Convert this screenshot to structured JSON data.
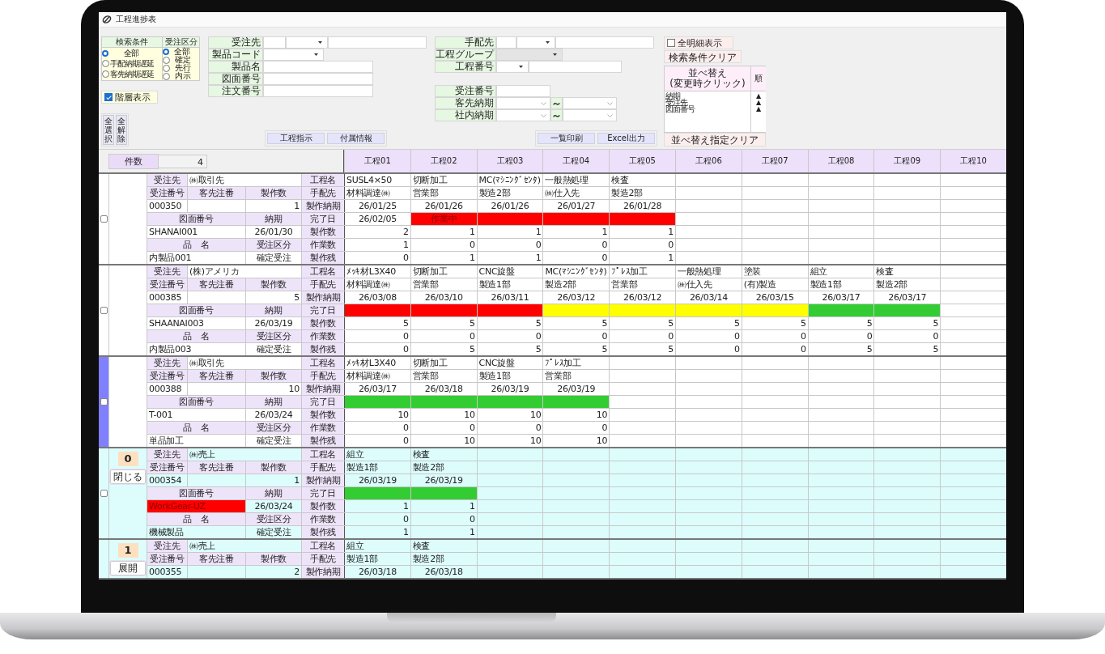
{
  "window": {
    "title": "工程進捗表"
  },
  "search": {
    "conditions": {
      "title": "検索条件",
      "options": [
        {
          "label": "全部",
          "selected": true
        },
        {
          "label": "手配納期遅延",
          "selected": false
        },
        {
          "label": "客先納期遅延",
          "selected": false
        }
      ]
    },
    "order_types": {
      "title": "受注区分",
      "options": [
        {
          "label": "全部",
          "selected": true
        },
        {
          "label": "確定",
          "selected": false
        },
        {
          "label": "先行",
          "selected": false
        },
        {
          "label": "内示",
          "selected": false
        }
      ]
    },
    "hierarchy": {
      "label": "階層表示",
      "checked": true
    },
    "select_buttons": [
      "全選択",
      "全解除"
    ],
    "fields_left": [
      {
        "label": "受注先",
        "kind": "code_combo",
        "disabled": false
      },
      {
        "label": "製品コード",
        "kind": "combo",
        "disabled": false
      },
      {
        "label": "製品名",
        "kind": "text",
        "disabled": false
      },
      {
        "label": "図面番号",
        "kind": "text",
        "disabled": false
      },
      {
        "label": "注文番号",
        "kind": "text",
        "disabled": false
      }
    ],
    "buttons_left": [
      "工程指示",
      "付属情報"
    ],
    "fields_right_top": [
      {
        "label": "手配先",
        "kind": "code_combo",
        "disabled": false
      },
      {
        "label": "工程グループ",
        "kind": "combo",
        "disabled": true
      },
      {
        "label": "工程番号",
        "kind": "combo_text",
        "disabled": false
      }
    ],
    "fields_right_bottom": [
      {
        "label": "受注番号",
        "kind": "text",
        "disabled": false
      },
      {
        "label": "客先納期",
        "kind": "date_range",
        "separator": "～",
        "disabled": false
      },
      {
        "label": "社内納期",
        "kind": "date_range",
        "separator": "～",
        "disabled": false
      }
    ],
    "buttons_right": [
      "一覧印刷",
      "Excel出力"
    ],
    "all_details": {
      "label": "全明細表示",
      "checked": false
    },
    "clear_button": "検索条件クリア",
    "sort": {
      "header_lines": [
        "並べ替え",
        "(変更時クリック)"
      ],
      "order_header": "順",
      "items": [
        {
          "label": "納期",
          "order": "▲"
        },
        {
          "label": "受注先",
          "order": "▲"
        },
        {
          "label": "図面番号",
          "order": "▲"
        }
      ]
    },
    "sort_clear_button": "並べ替え指定クリア"
  },
  "table": {
    "count_label": "件数",
    "count": "4",
    "columns": [
      "工程01",
      "工程02",
      "工程03",
      "工程04",
      "工程05",
      "工程06",
      "工程07",
      "工程08",
      "工程09",
      "工程10"
    ],
    "groups": [
      {
        "selected": false,
        "current": false,
        "color": "#ffffff",
        "labels": [
          "受注先",
          "工程名",
          "受注番号",
          "客先注番",
          "製作数",
          "手配先",
          "製作納期",
          "図面番号",
          "納期",
          "完了日",
          "製作数",
          "品　名",
          "受注区分",
          "作業数",
          "製作残"
        ],
        "customer": "㈱取引先",
        "order_no": "000350",
        "quantity": "1",
        "drawing": "SHANAI001",
        "drawing_alert": false,
        "due": "26/01/30",
        "product": "内製品001",
        "order_type": "確定受注",
        "processes": [
          {
            "name": "SUSL4×50",
            "vendor": "材料調達㈱",
            "due": "26/01/25",
            "completed": "26/02/05",
            "made": "2",
            "worked": "1",
            "remaining": "0"
          },
          {
            "name": "切断加工",
            "vendor": "営業部",
            "due": "26/01/26",
            "color": "#ff0000",
            "status": "作業中",
            "made": "1",
            "worked": "0",
            "remaining": "1"
          },
          {
            "name": "MC(ﾏｼﾆﾝｸﾞｾﾝﾀ)",
            "vendor": "製造2部",
            "due": "26/01/26",
            "color": "#ff0000",
            "made": "1",
            "worked": "0",
            "remaining": "1"
          },
          {
            "name": "一般熱処理",
            "vendor": "㈱仕入先",
            "due": "26/01/27",
            "color": "#ff0000",
            "made": "1",
            "worked": "0",
            "remaining": "0"
          },
          {
            "name": "検査",
            "vendor": "製造2部",
            "due": "26/01/28",
            "color": "#ff0000",
            "made": "1",
            "worked": "0",
            "remaining": "1"
          }
        ]
      },
      {
        "selected": false,
        "current": false,
        "color": "#ffffff",
        "labels": [
          "受注先",
          "工程名",
          "受注番号",
          "客先注番",
          "製作数",
          "手配先",
          "製作納期",
          "図面番号",
          "納期",
          "完了日",
          "製作数",
          "品　名",
          "受注区分",
          "作業数",
          "製作残"
        ],
        "customer": "(株)アメリカ",
        "order_no": "000385",
        "quantity": "5",
        "drawing": "SHAANAI003",
        "drawing_alert": false,
        "due": "26/03/19",
        "product": "内製品003",
        "order_type": "確定受注",
        "processes": [
          {
            "name": "ﾒｯｷ材L3X40",
            "vendor": "材料調達㈱",
            "due": "26/03/08",
            "color": "#ff0000",
            "made": "5",
            "worked": "0",
            "remaining": "0"
          },
          {
            "name": "切断加工",
            "vendor": "営業部",
            "due": "26/03/10",
            "color": "#ff0000",
            "made": "5",
            "worked": "0",
            "remaining": "5"
          },
          {
            "name": "CNC旋盤",
            "vendor": "製造1部",
            "due": "26/03/11",
            "color": "#ff0000",
            "made": "5",
            "worked": "0",
            "remaining": "5"
          },
          {
            "name": "MC(ﾏｼﾆﾝｸﾞｾﾝﾀ)",
            "vendor": "製造2部",
            "due": "26/03/12",
            "color": "#ffff00",
            "made": "5",
            "worked": "0",
            "remaining": "5"
          },
          {
            "name": "ﾌﾟﾚｽ加工",
            "vendor": "営業部",
            "due": "26/03/12",
            "color": "#ffff00",
            "made": "5",
            "worked": "0",
            "remaining": "5"
          },
          {
            "name": "一般熱処理",
            "vendor": "㈱仕入先",
            "due": "26/03/14",
            "color": "#ffff00",
            "made": "5",
            "worked": "0",
            "remaining": "0"
          },
          {
            "name": "塗装",
            "vendor": "(有)製造",
            "due": "26/03/15",
            "color": "#ffff00",
            "made": "5",
            "worked": "0",
            "remaining": "0"
          },
          {
            "name": "組立",
            "vendor": "製造1部",
            "due": "26/03/17",
            "color": "#33cc33",
            "made": "5",
            "worked": "0",
            "remaining": "5"
          },
          {
            "name": "検査",
            "vendor": "製造2部",
            "due": "26/03/17",
            "color": "#33cc33",
            "made": "5",
            "worked": "0",
            "remaining": "5"
          }
        ]
      },
      {
        "selected": false,
        "current": true,
        "color": "#ffffff",
        "labels": [
          "受注先",
          "工程名",
          "受注番号",
          "客先注番",
          "製作数",
          "手配先",
          "製作納期",
          "図面番号",
          "納期",
          "完了日",
          "製作数",
          "品　名",
          "受注区分",
          "作業数",
          "製作残"
        ],
        "customer": "㈱取引先",
        "order_no": "000388",
        "quantity": "10",
        "drawing": "T-001",
        "drawing_alert": false,
        "due": "26/03/24",
        "product": "単品加工",
        "order_type": "確定受注",
        "processes": [
          {
            "name": "ﾒｯｷ材L3X40",
            "vendor": "材料調達㈱",
            "due": "26/03/17",
            "color": "#33cc33",
            "made": "10",
            "worked": "0",
            "remaining": "0"
          },
          {
            "name": "切断加工",
            "vendor": "営業部",
            "due": "26/03/18",
            "color": "#33cc33",
            "made": "10",
            "worked": "0",
            "remaining": "10"
          },
          {
            "name": "CNC旋盤",
            "vendor": "製造1部",
            "due": "26/03/19",
            "color": "#33cc33",
            "made": "10",
            "worked": "0",
            "remaining": "10"
          },
          {
            "name": "ﾌﾟﾚｽ加工",
            "vendor": "営業部",
            "due": "26/03/19",
            "color": "#33cc33",
            "made": "10",
            "worked": "0",
            "remaining": "10"
          }
        ]
      },
      {
        "selected": false,
        "current": false,
        "color": "#ddfdfd",
        "badge": "0",
        "toggle": "閉じる",
        "labels": [
          "受注先",
          "工程名",
          "受注番号",
          "客先注番",
          "製作数",
          "手配先",
          "製作納期",
          "図面番号",
          "納期",
          "完了日",
          "製作数",
          "品　名",
          "受注区分",
          "作業数",
          "製作残"
        ],
        "customer": "㈱売上",
        "order_no": "000354",
        "quantity": "1",
        "drawing": "WorkGear-UZ",
        "drawing_alert": true,
        "due": "26/03/24",
        "product": "機械製品",
        "order_type": "確定受注",
        "processes": [
          {
            "name": "組立",
            "vendor": "製造1部",
            "due": "26/03/19",
            "color": "#33cc33",
            "made": "1",
            "worked": "0",
            "remaining": "1"
          },
          {
            "name": "検査",
            "vendor": "製造2部",
            "due": "26/03/19",
            "color": "#33cc33",
            "made": "1",
            "worked": "0",
            "remaining": "1"
          }
        ]
      },
      {
        "current": false,
        "color": "#ddfdfd",
        "badge": "1",
        "toggle": "展開",
        "labels": [
          "受注先",
          "工程名",
          "受注番号",
          "客先注番",
          "製作数",
          "手配先",
          "製作納期"
        ],
        "customer": "㈱売上",
        "order_no": "000355",
        "quantity": "2",
        "processes": [
          {
            "name": "組立",
            "vendor": "製造1部",
            "due": "26/03/18"
          },
          {
            "name": "検査",
            "vendor": "製造2部",
            "due": "26/03/18"
          }
        ]
      }
    ]
  }
}
